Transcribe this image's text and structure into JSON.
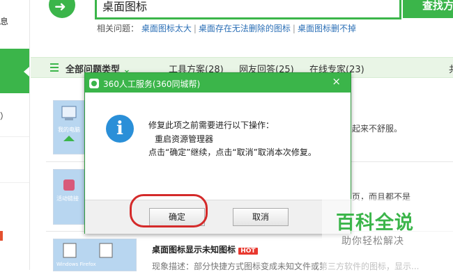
{
  "header": {
    "back_icon": "arrow-left-icon",
    "search_value": "桌面图标",
    "search_button": "查找方"
  },
  "related": {
    "label": "相关问题：",
    "links": [
      "桌面图标太大",
      "桌面存在无法删除的图标",
      "桌面图标删不掉"
    ]
  },
  "left": {
    "t1": "息",
    "t2": "）",
    "t3": "1"
  },
  "categories": {
    "all": "全部问题类型",
    "tools": "工具方案(28)",
    "net": "网友回答(25)",
    "expert": "在线专家(23)",
    "more": "共"
  },
  "rows": [
    {
      "snippet": "起来不舒服。"
    },
    {
      "snippet": "页，而且都不是"
    },
    {
      "title": "桌面图标显示未知图标",
      "badge": "HOT",
      "desc": "现象描述：部分快捷方式图标变成未知文件或第三方软件的图标，显示..."
    }
  ],
  "thumbs": {
    "t1_label": "我的电脑",
    "t2_label": "活动链接",
    "t3_label": "Windows Firefox"
  },
  "dialog": {
    "title": "360人工服务(360同城帮)",
    "close": "×",
    "line1": "修复此项之前需要进行以下操作：",
    "line2": "重启资源管理器",
    "line3": "点击“确定”继续，点击“取消”取消本次修复。",
    "ok": "确定",
    "cancel": "取消",
    "info_glyph": "i"
  },
  "watermark": {
    "big": "百科全说",
    "small": "助你轻松解决"
  },
  "colors": {
    "accent": "#3bb54a",
    "link": "#2b6fb6",
    "info": "#2a8fd8",
    "highlight": "#d42a2a"
  }
}
